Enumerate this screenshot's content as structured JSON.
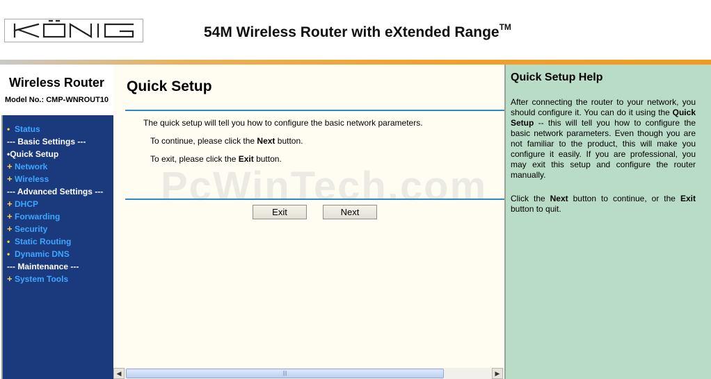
{
  "header": {
    "logo_text": "KÖNIG",
    "title": "54M Wireless Router with eXtended Range",
    "trademark": "TM"
  },
  "sidebar": {
    "title": "Wireless Router",
    "model": "Model No.: CMP-WNROUT10",
    "items": [
      {
        "label": "Status"
      },
      {
        "label": "--- Basic Settings ---"
      },
      {
        "label": "Quick Setup"
      },
      {
        "label": "Network"
      },
      {
        "label": "Wireless"
      },
      {
        "label": "--- Advanced Settings ---"
      },
      {
        "label": "DHCP"
      },
      {
        "label": "Forwarding"
      },
      {
        "label": "Security"
      },
      {
        "label": "Static Routing"
      },
      {
        "label": "Dynamic DNS"
      },
      {
        "label": "--- Maintenance ---"
      },
      {
        "label": "System Tools"
      }
    ]
  },
  "main": {
    "title": "Quick Setup",
    "intro": "The quick setup will tell you how to configure the basic network parameters.",
    "continue_pre": "To continue, please click the ",
    "continue_bold": "Next",
    "continue_post": " button.",
    "exit_pre": "To exit, please click the ",
    "exit_bold": "Exit",
    "exit_post": " button.",
    "exit_button": "Exit",
    "next_button": "Next",
    "watermark": "PcWinTech.com"
  },
  "help": {
    "title": "Quick Setup Help",
    "p1_a": "After connecting the router to your network, you should configure it. You can do it using the ",
    "p1_b": "Quick Setup",
    "p1_c": " -- this will tell you how to configure the basic network parameters. Even though you are not familiar to the product, this will make you configure it easily. If you are professional, you may exit this setup and configure the router manually.",
    "p2_a": "Click the ",
    "p2_b": "Next",
    "p2_c": " button to continue, or the ",
    "p2_d": "Exit",
    "p2_e": " button to quit."
  }
}
